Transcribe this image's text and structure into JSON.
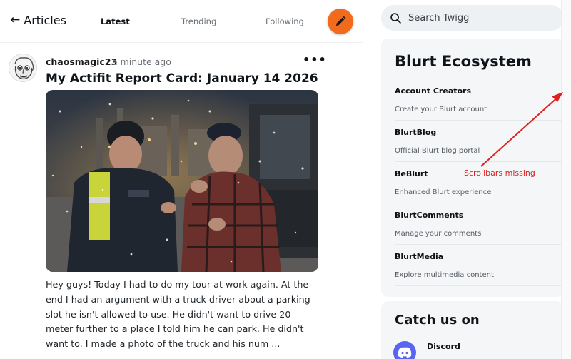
{
  "header": {
    "back_label": "Articles",
    "tabs": [
      {
        "label": "Latest",
        "active": true
      },
      {
        "label": "Trending",
        "active": false
      },
      {
        "label": "Following",
        "active": false
      }
    ],
    "fab_icon": "pencil-icon"
  },
  "post": {
    "author": "chaosmagic23",
    "time": "· a minute ago",
    "more_label": "•••",
    "title": "My Actifit Report Card: January 14 2026",
    "body": "Hey guys! Today I had to do my tour at work again. At the end I had an argument with a truck driver about a parking slot he isn't allowed to use. He didn't want to drive 20 meter further to a place I told him he can park. He didn't want to. I made a photo of the truck and his num ..."
  },
  "sidebar": {
    "search_placeholder": "Search Twigg",
    "ecosystem": {
      "title": "Blurt Ecosystem",
      "items": [
        {
          "name": "Account Creators",
          "desc": "Create your Blurt account"
        },
        {
          "name": "BlurtBlog",
          "desc": "Official Blurt blog portal"
        },
        {
          "name": "BeBlurt",
          "desc": "Enhanced Blurt experience"
        },
        {
          "name": "BlurtComments",
          "desc": "Manage your comments"
        },
        {
          "name": "BlurtMedia",
          "desc": "Explore multimedia content"
        }
      ]
    },
    "catch": {
      "title": "Catch us on",
      "items": [
        {
          "name": "Discord"
        }
      ]
    }
  },
  "annotation": {
    "text": "Scrollbars missing"
  },
  "colors": {
    "accent": "#f26a1b",
    "annotation": "#e0201d",
    "discord": "#5865f2"
  }
}
